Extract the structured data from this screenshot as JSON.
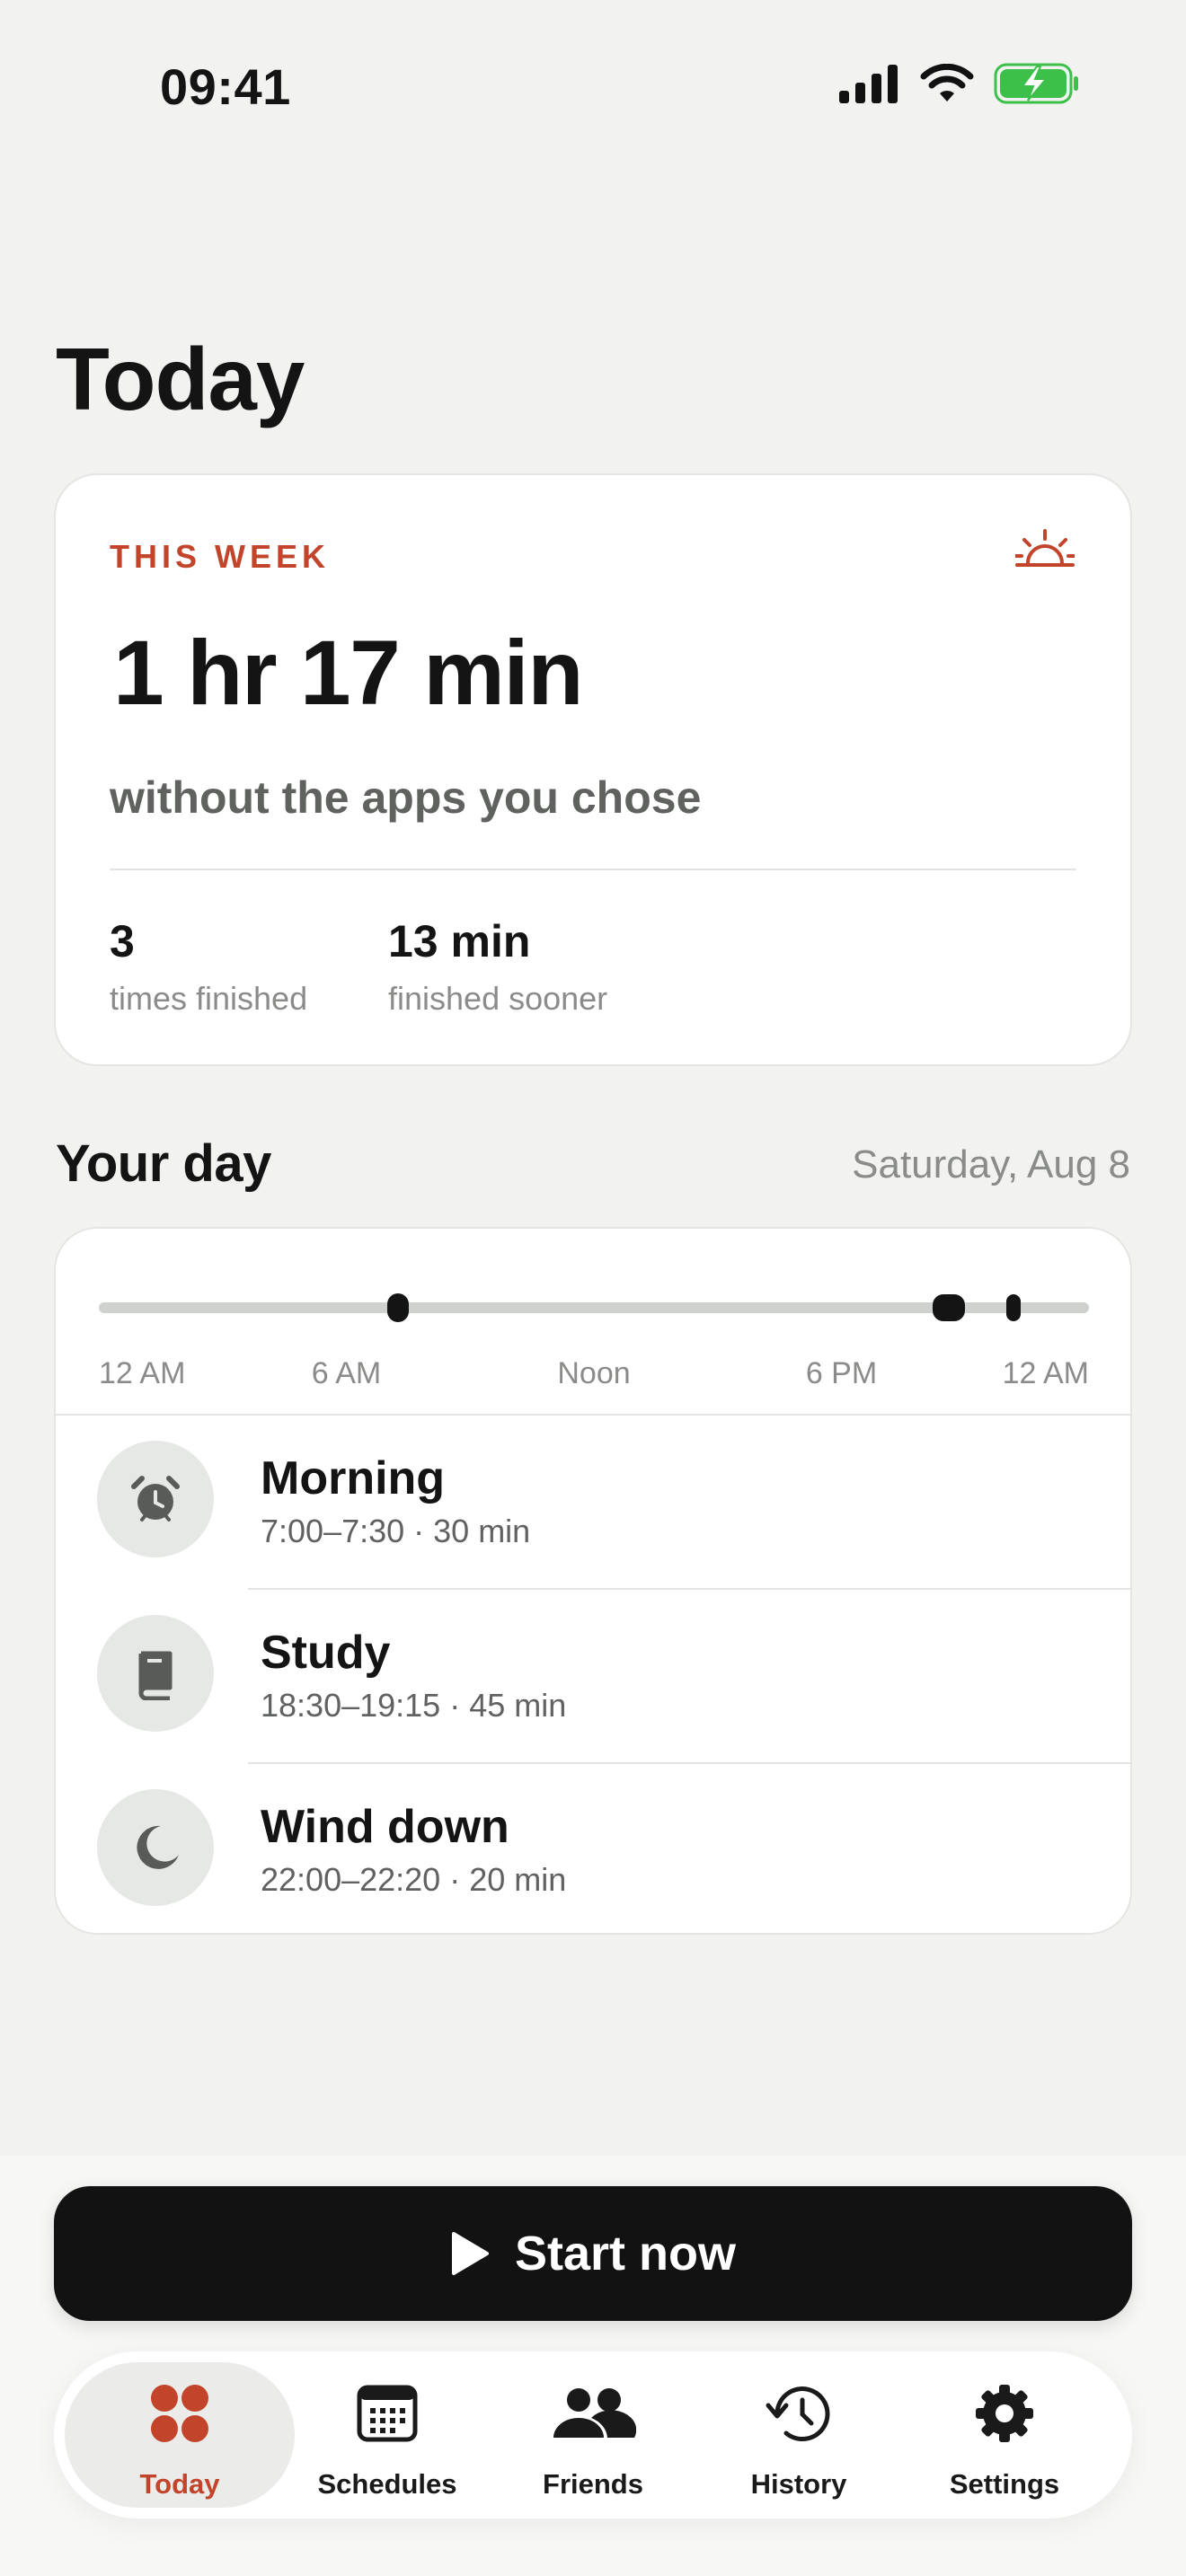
{
  "status_bar": {
    "time": "09:41",
    "icons": [
      "cellular-signal-icon",
      "wifi-icon",
      "battery-charging-icon"
    ],
    "battery_color": "#3cc04a"
  },
  "page": {
    "title": "Today"
  },
  "week_card": {
    "eyebrow": "THIS WEEK",
    "icon": "sunrise-icon",
    "total_time": "1 hr 17 min",
    "subtitle": "without the apps you chose",
    "stats": [
      {
        "value": "3",
        "label": "times finished"
      },
      {
        "value": "13 min",
        "label": "finished sooner"
      }
    ]
  },
  "day_section": {
    "heading": "Your day",
    "date": "Saturday, Aug 8",
    "timeline_labels": [
      "12 AM",
      "6 AM",
      "Noon",
      "6 PM",
      "12 AM"
    ],
    "timeline_marks_hours": [
      7.25,
      20.6,
      22.16
    ],
    "schedules": [
      {
        "name": "Morning",
        "time": "7:00–7:30 · 30 min",
        "icon": "alarm-clock-icon"
      },
      {
        "name": "Study",
        "time": "18:30–19:15 · 45 min",
        "icon": "book-icon"
      },
      {
        "name": "Wind down",
        "time": "22:00–22:20 · 20 min",
        "icon": "moon-icon"
      }
    ]
  },
  "start_button": {
    "label": "Start now",
    "icon": "play-icon"
  },
  "tab_bar": {
    "active": "Today",
    "accent": "#c2452b",
    "tabs": [
      {
        "label": "Today",
        "icon": "dots-grid-icon"
      },
      {
        "label": "Schedules",
        "icon": "calendar-icon"
      },
      {
        "label": "Friends",
        "icon": "people-icon"
      },
      {
        "label": "History",
        "icon": "history-clock-icon"
      },
      {
        "label": "Settings",
        "icon": "gear-icon"
      }
    ]
  }
}
